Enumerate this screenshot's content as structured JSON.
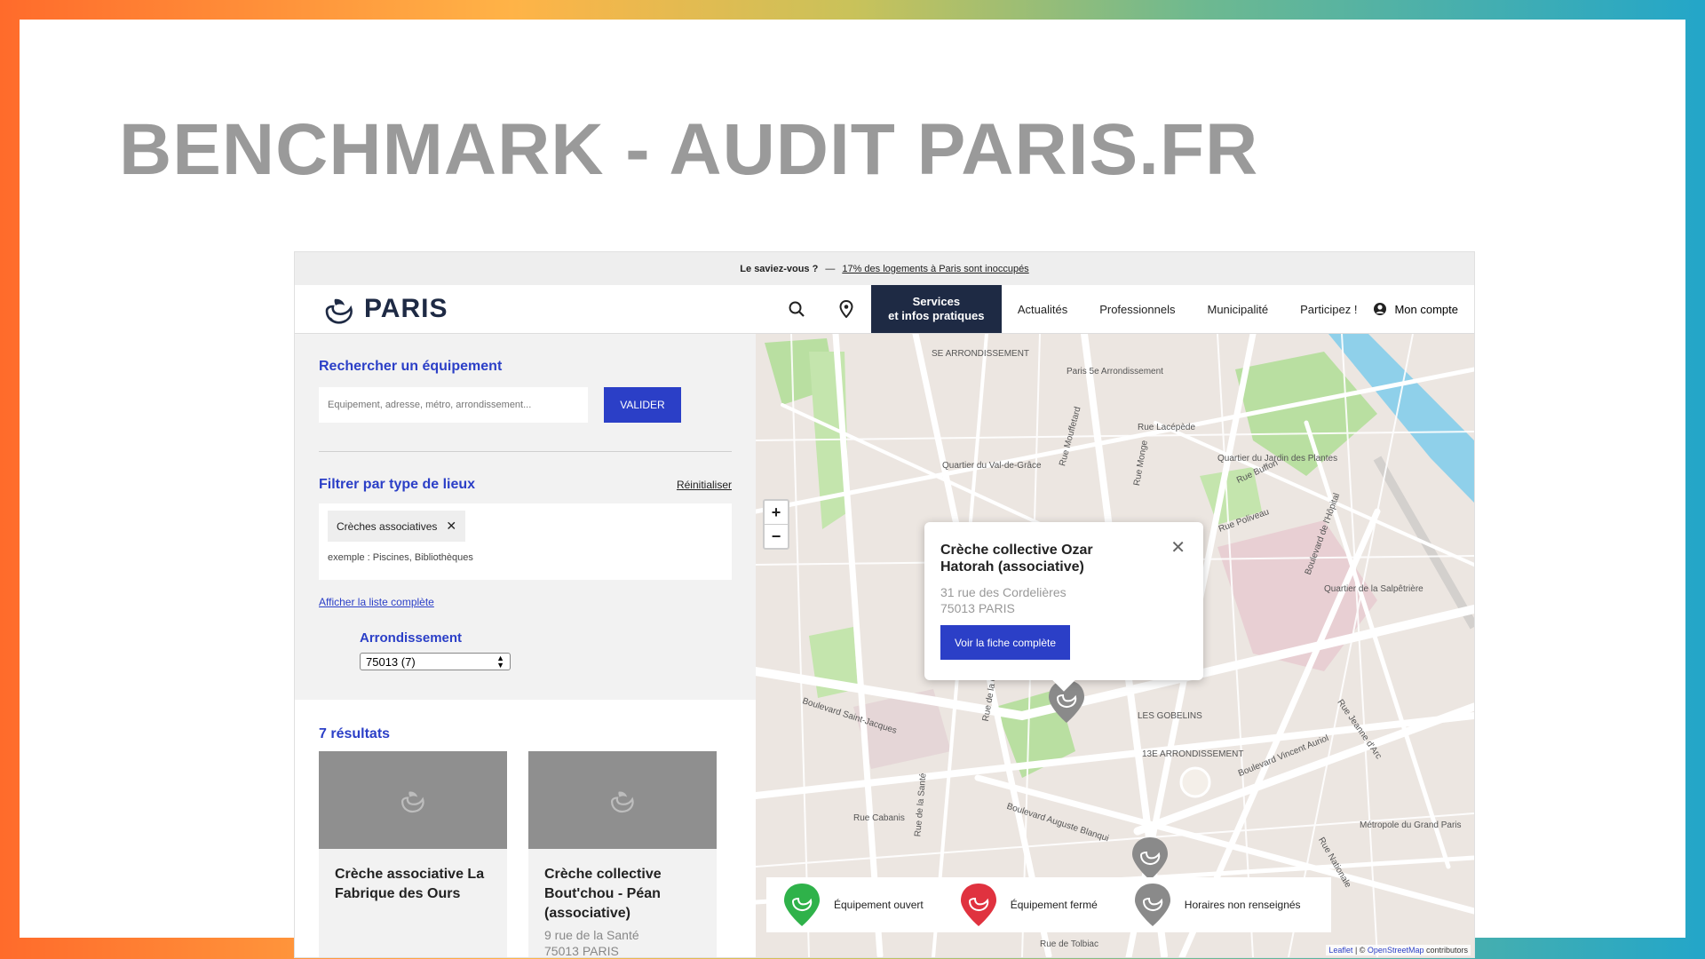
{
  "slide": {
    "title": "BENCHMARK - AUDIT PARIS.FR"
  },
  "topbar": {
    "prefix": "Le saviez-vous ?",
    "dash": "—",
    "link": "17% des logements à Paris sont inoccupés"
  },
  "header": {
    "logo_text": "PARIS",
    "nav": {
      "services_line1": "Services",
      "services_line2": "et infos pratiques",
      "items": [
        "Actualités",
        "Professionnels",
        "Municipalité",
        "Participez !"
      ],
      "account": "Mon compte"
    }
  },
  "search": {
    "title": "Rechercher un équipement",
    "placeholder": "Equipement, adresse, métro, arrondissement...",
    "button": "VALIDER"
  },
  "filter": {
    "title": "Filtrer par type de lieux",
    "reset": "Réinitialiser",
    "chip": "Crèches associatives",
    "example": "exemple : Piscines, Bibliothèques",
    "list_link": "Afficher la liste complète",
    "arr_label": "Arrondissement",
    "arr_value": "75013 (7)"
  },
  "results": {
    "count": "7 résultats",
    "cards": [
      {
        "name": "Crèche associative La Fabrique des Ours",
        "addr": ""
      },
      {
        "name": "Crèche collective Bout'chou - Péan (associative)",
        "addr": "9 rue de la Santé",
        "addr2": "75013 PARIS"
      }
    ]
  },
  "map": {
    "popup": {
      "title": "Crèche collective Ozar Hatorah (associative)",
      "addr1": "31 rue des Cordelières",
      "addr2": "75013 PARIS",
      "button": "Voir la fiche complète"
    },
    "legend": {
      "open": "Équipement ouvert",
      "closed": "Équipement fermé",
      "unknown": "Horaires non renseignés"
    },
    "colors": {
      "open": "#2fb24a",
      "closed": "#e0323f",
      "unknown": "#8a8a8a"
    },
    "attribution": {
      "leaflet": "Leaflet",
      "sep": " | © ",
      "osm": "OpenStreetMap",
      "tail": " contributors"
    },
    "labels": [
      "SE ARRONDISSEMENT",
      "Paris 5e Arrondissement",
      "Quartier du Val-de-Grâce",
      "Quartier du Jardin des Plantes",
      "Quartier de la Salpêtrière",
      "LES GOBELINS",
      "13E ARRONDISSEMENT",
      "Métropole du Grand Paris",
      "Boulevard Saint-Jacques",
      "Boulevard Auguste Blanqui",
      "Boulevard Vincent Auriol",
      "Rue de Tolbiac",
      "Rue Lacépède",
      "Rue Buffon",
      "Rue Poliveau",
      "Rue Monge",
      "Rue Mouffetard",
      "Boulevard de l'Hôpital",
      "Rue Jeanne d'Arc",
      "Rue Nationale",
      "Rue de la Glacière",
      "Rue Cabanis",
      "Rue de la Santé"
    ]
  }
}
